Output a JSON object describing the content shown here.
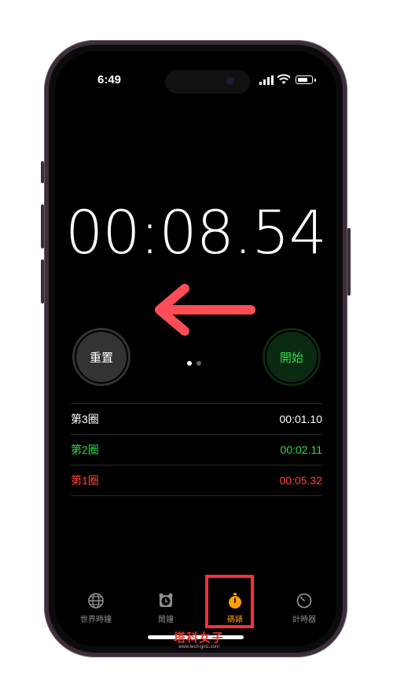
{
  "status_bar": {
    "time": "6:49"
  },
  "stopwatch": {
    "display": "00:08.54"
  },
  "controls": {
    "reset_label": "重置",
    "start_label": "開始",
    "page_count": 2,
    "active_page": 1
  },
  "laps": [
    {
      "label": "第3圈",
      "time": "00:01.10",
      "color": "#ffffff"
    },
    {
      "label": "第2圈",
      "time": "00:02.11",
      "color": "#32d74b"
    },
    {
      "label": "第1圈",
      "time": "00:05.32",
      "color": "#ff453a"
    }
  ],
  "tab_bar": {
    "items": [
      {
        "label": "世界時鐘",
        "icon": "globe-icon",
        "active": false
      },
      {
        "label": "鬧鐘",
        "icon": "alarm-clock-icon",
        "active": false
      },
      {
        "label": "碼錶",
        "icon": "stopwatch-icon",
        "active": true
      },
      {
        "label": "計時器",
        "icon": "timer-icon",
        "active": false
      }
    ]
  },
  "annotations": {
    "arrow_direction": "left",
    "arrow_color": "#ff4d57",
    "highlight_color": "#ff2d3a",
    "highlight_target": "stopwatch-tab"
  },
  "watermark": {
    "main": "塔科女子",
    "sub": "www.tech-girlz.com"
  },
  "colors": {
    "accent": "#ff9f0a",
    "start_green": "#32d74b",
    "lap_red": "#ff453a"
  }
}
